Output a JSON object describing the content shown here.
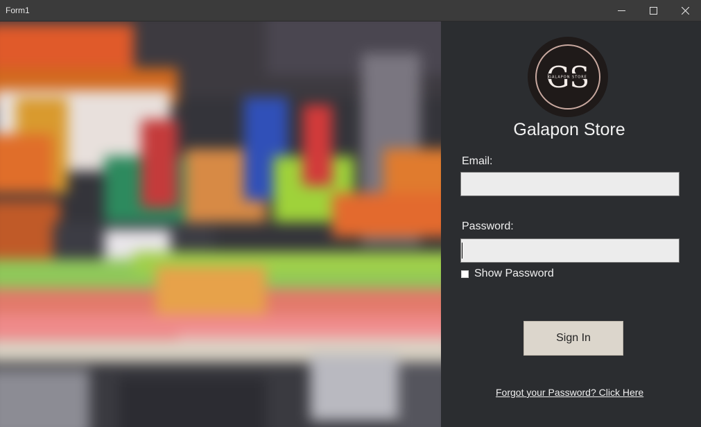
{
  "window": {
    "title": "Form1"
  },
  "icons": {
    "minimize": "minimize-icon",
    "maximize": "maximize-icon",
    "close": "close-icon"
  },
  "branding": {
    "logo_monogram": "GS",
    "logo_ring_text": "GALAPON STORE",
    "store_name": "Galapon Store"
  },
  "form": {
    "email_label": "Email:",
    "email_value": "",
    "password_label": "Password:",
    "password_value": "",
    "show_password_label": "Show Password",
    "show_password_checked": false,
    "sign_in_label": "Sign In",
    "forgot_link": "Forgot your Password? Click Here"
  },
  "colors": {
    "panel_bg": "#2b2d30",
    "titlebar_bg": "#3b3b3b",
    "button_bg": "#dcd6cc",
    "field_bg": "#ececec"
  }
}
